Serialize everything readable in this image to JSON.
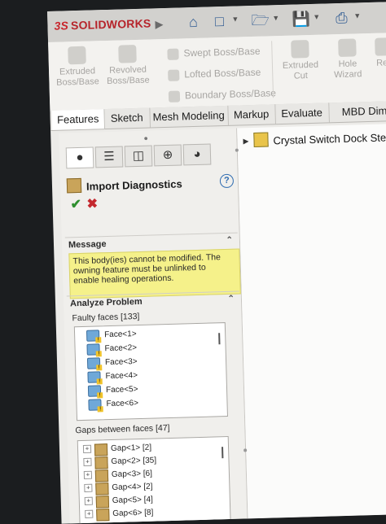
{
  "app": {
    "brand_prefix": "3S",
    "brand_name": "SOLIDWORKS",
    "accent_color": "#c8262d"
  },
  "quick_access": [
    "home-icon",
    "new-document-icon",
    "open-folder-icon",
    "save-icon",
    "print-icon"
  ],
  "ribbon": {
    "buttons": [
      {
        "label1": "Extruded",
        "label2": "Boss/Base"
      },
      {
        "label1": "Revolved",
        "label2": "Boss/Base"
      },
      {
        "label1": "Extruded",
        "label2": "Cut"
      },
      {
        "label1": "Hole",
        "label2": "Wizard"
      },
      {
        "label1": "Rev",
        "label2": ""
      }
    ],
    "small": [
      "Swept Boss/Base",
      "Lofted Boss/Base",
      "Boundary Boss/Base"
    ]
  },
  "tabs": [
    "Features",
    "Sketch",
    "Mesh Modeling",
    "Markup",
    "Evaluate",
    "MBD Dim"
  ],
  "panel_tabs": [
    "feature-manager-icon",
    "property-manager-icon",
    "configuration-manager-icon",
    "dimxpert-icon",
    "display-manager-icon"
  ],
  "property_manager": {
    "title": "Import Diagnostics",
    "help": "?",
    "message_header": "Message",
    "message_line1": "This body(ies) cannot be modified. The",
    "message_line2": "owning feature must be unlinked to",
    "message_line3": "enable healing operations.",
    "analyze_header": "Analyze Problem",
    "faulty_label": "Faulty faces [133]",
    "faces": [
      "Face<1>",
      "Face<2>",
      "Face<3>",
      "Face<4>",
      "Face<5>",
      "Face<6>"
    ],
    "gaps_label": "Gaps between faces [47]",
    "gaps": [
      "Gap<1> [2]",
      "Gap<2> [35]",
      "Gap<3> [6]",
      "Gap<4> [2]",
      "Gap<5> [4]",
      "Gap<6> [8]"
    ]
  },
  "tree": {
    "root": "Crystal Switch Dock Ste"
  }
}
